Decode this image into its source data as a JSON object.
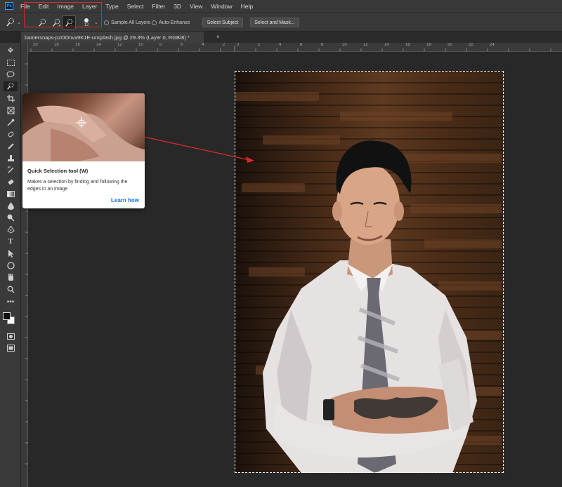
{
  "menu": {
    "logo": "Ps",
    "items": [
      "File",
      "Edit",
      "Image",
      "Layer",
      "Type",
      "Select",
      "Filter",
      "3D",
      "View",
      "Window",
      "Help"
    ]
  },
  "options": {
    "brush_size": "12",
    "sample_all_layers": "Sample All Layers",
    "auto_enhance": "Auto-Enhance",
    "select_subject": "Select Subject",
    "select_and_mask": "Select and Mask..."
  },
  "document": {
    "tab_title": "bantersnaps-pzOOnvx9K1E-unsplash.jpg @ 29.3% (Layer 0, RGB/8) *",
    "close": "×"
  },
  "ruler": {
    "top_labels": [
      "20",
      "18",
      "16",
      "14",
      "12",
      "10",
      "8",
      "6",
      "4",
      "2",
      "0",
      "2",
      "4",
      "6",
      "8",
      "10",
      "12",
      "14",
      "16",
      "18",
      "20",
      "22",
      "24"
    ]
  },
  "tooltip": {
    "title": "Quick Selection tool (W)",
    "description": "Makes a selection by finding and following the edges in an image",
    "link": "Learn how"
  },
  "colors": {
    "highlight": "#d42a2a",
    "link": "#1473e6",
    "foreground": "#111111",
    "background": "#ffffff"
  }
}
